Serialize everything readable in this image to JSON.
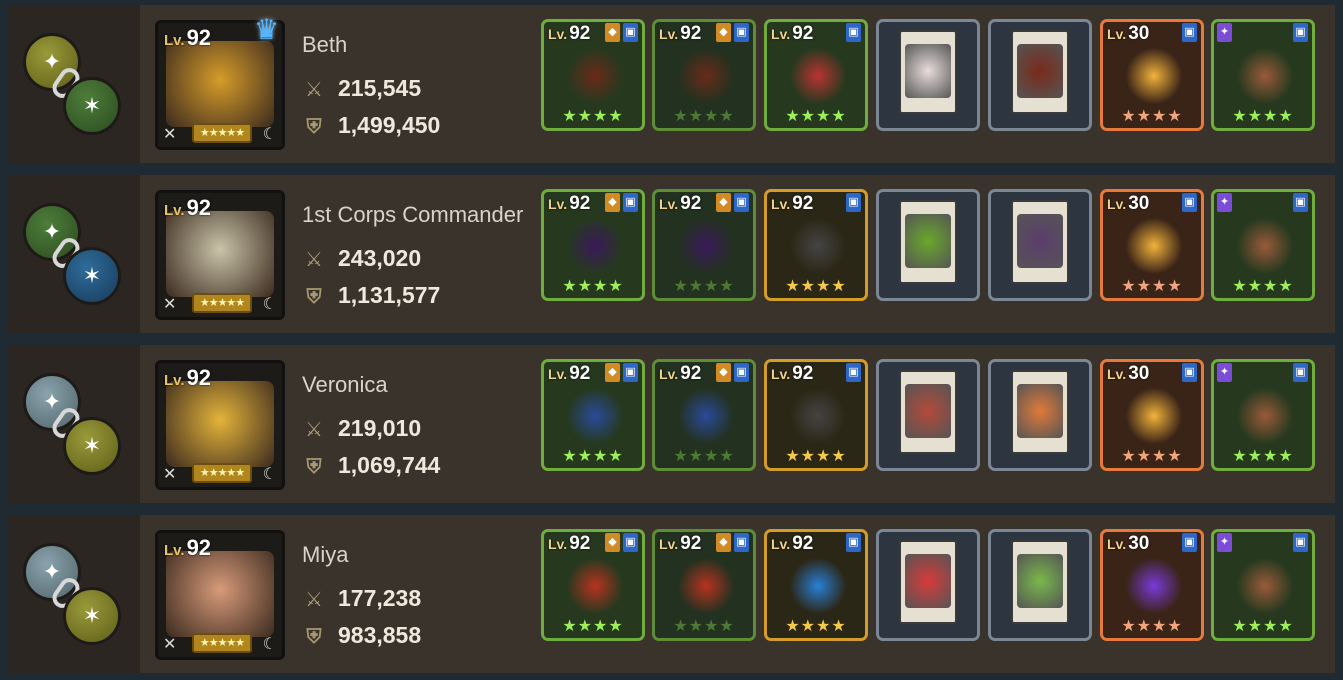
{
  "rows": [
    {
      "name": "Beth",
      "level": "92",
      "lv_label": "Lv.",
      "atk": "215,545",
      "def": "1,499,450",
      "crown": true,
      "orb1": "olive",
      "orb2": "green",
      "class_icon": "swords",
      "elem_icon": "moon",
      "art": "#d69c2a",
      "items": {
        "w1_lv": "92",
        "w2_lv": "92",
        "acc_lv": "92",
        "acc_type": "green",
        "costume_lv": "30",
        "lv_label": "Lv.",
        "w_color": "#6a2a1a",
        "acc_color": "#b33",
        "card1": "#e8dcdc",
        "card2": "#7a2a1a",
        "costume": "#f2b33b"
      }
    },
    {
      "name": "1st Corps Commander",
      "level": "92",
      "lv_label": "Lv.",
      "atk": "243,020",
      "def": "1,131,577",
      "crown": false,
      "orb1": "green",
      "orb2": "blue",
      "class_icon": "swords",
      "elem_icon": "moon",
      "art": "#c9c3a8",
      "items": {
        "w1_lv": "92",
        "w2_lv": "92",
        "acc_lv": "92",
        "acc_type": "gold",
        "costume_lv": "30",
        "lv_label": "Lv.",
        "w_color": "#3a1a5a",
        "acc_color": "#444",
        "card1": "#6aa82a",
        "card2": "#5b3d6d",
        "costume": "#f2b33b"
      }
    },
    {
      "name": "Veronica",
      "level": "92",
      "lv_label": "Lv.",
      "atk": "219,010",
      "def": "1,069,744",
      "crown": false,
      "orb1": "grey",
      "orb2": "olive",
      "class_icon": "staff",
      "elem_icon": "water",
      "art": "#e3b33a",
      "items": {
        "w1_lv": "92",
        "w2_lv": "92",
        "acc_lv": "92",
        "acc_type": "gold",
        "costume_lv": "30",
        "lv_label": "Lv.",
        "w_color": "#2a4a9a",
        "acc_color": "#444",
        "card1": "#b44a3a",
        "card2": "#e07a3a",
        "costume": "#f2b33b"
      }
    },
    {
      "name": "Miya",
      "level": "92",
      "lv_label": "Lv.",
      "atk": "177,238",
      "def": "983,858",
      "crown": false,
      "orb1": "grey",
      "orb2": "olive",
      "class_icon": "staff",
      "elem_icon": "fire",
      "art": "#d79a7a",
      "items": {
        "w1_lv": "92",
        "w2_lv": "92",
        "acc_lv": "92",
        "acc_type": "gold",
        "costume_lv": "30",
        "lv_label": "Lv.",
        "w_color": "#b8321f",
        "acc_color": "#2a7fd8",
        "card1": "#d83a3a",
        "card2": "#7ab84a",
        "costume": "#7a3ad8"
      }
    }
  ],
  "stars4": "★★★★",
  "stars5": "★★★★★",
  "icons": {
    "atk": "⚔",
    "def": "⛨",
    "crown": "♛"
  }
}
